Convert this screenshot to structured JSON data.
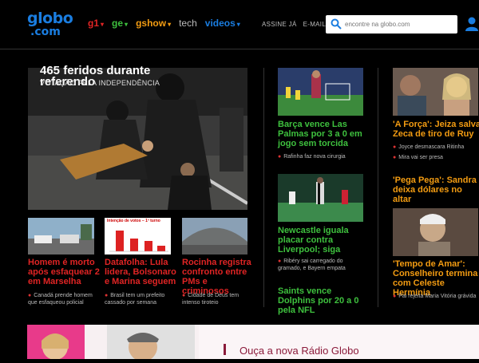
{
  "header": {
    "logo_line1": "globo",
    "logo_line2": ".com",
    "nav": [
      {
        "label": "g1",
        "color": "#e02424"
      },
      {
        "label": "ge",
        "color": "#3ec03e"
      },
      {
        "label": "gshow",
        "color": "#f39c12"
      },
      {
        "label": "tech",
        "color": "#bbbbbb"
      },
      {
        "label": "videos",
        "color": "#1a7de0"
      }
    ],
    "assine": "ASSINE JÁ",
    "email": "E-MAIL",
    "search_placeholder": "encontre na globo.com"
  },
  "hero": {
    "title": "465 feridos durante referendo",
    "subtitle": "VOTAÇÃO PELA INDEPENDÊNCIA"
  },
  "cards": {
    "c1": {
      "title": "Homem é morto após esfaquear 2 em Marselha",
      "sub": "Canadá prende homem que esfaqueou policial"
    },
    "c2": {
      "title": "Datafolha: Lula lidera, Bolsonaro e Marina seguem",
      "sub": "Brasil tem um prefeito cassado por semana",
      "chart_title": "Intenção de votos – 1º turno"
    },
    "c3": {
      "title": "Rocinha registra confronto entre PMs e criminosos",
      "sub": "Cidade de Deus tem intenso tiroteio"
    },
    "sp1": {
      "title": "Barça vence Las Palmas por 3 a 0 em jogo sem torcida",
      "sub": "Rafinha faz nova cirurgia"
    },
    "sp2": {
      "title": "Newcastle iguala placar contra Liverpool; siga",
      "sub": "Ribéry sai carregado do gramado, e Bayern empata"
    },
    "sp3": {
      "title": "Saints vence Dolphins por 20 a 0 pela NFL"
    },
    "ent1": {
      "title": "'A Força': Jeiza salva Zeca de tiro de Ruy",
      "subs": [
        "Joyce desmascara Ritinha",
        "Mira vai ser presa"
      ]
    },
    "ent2": {
      "title": "'Pega Pega': Sandra deixa dólares no altar"
    },
    "ent3": {
      "title": "'Tempo de Amar': Conselheiro termina com Celeste Hermínia",
      "sub": "Pai rejeita Maria Vitória grávida"
    }
  },
  "banner": {
    "title": "Ouça a nova Rádio Globo"
  }
}
